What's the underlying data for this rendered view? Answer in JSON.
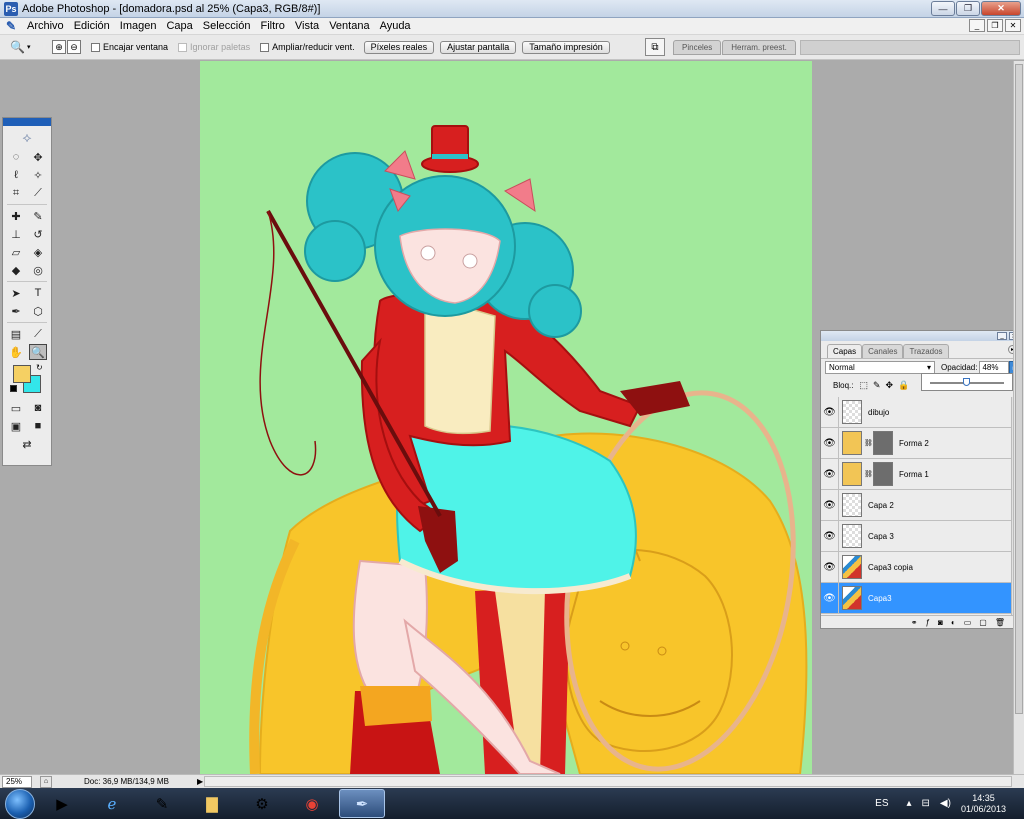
{
  "window": {
    "title": "Adobe Photoshop - [domadora.psd al 25% (Capa3, RGB/8#)]",
    "app_icon": "ps-icon",
    "buttons": [
      "minimize-icon",
      "restore-icon",
      "close-icon"
    ]
  },
  "menu": {
    "items": [
      "Archivo",
      "Edición",
      "Imagen",
      "Capa",
      "Selección",
      "Filtro",
      "Vista",
      "Ventana",
      "Ayuda"
    ]
  },
  "options": {
    "check_fit_window": "Encajar ventana",
    "check_ignore_palettes": "Ignorar paletas",
    "check_resize_windows": "Ampliar/reducir vent.",
    "btn_actual_pixels": "Píxeles reales",
    "btn_fit_screen": "Ajustar pantalla",
    "btn_print_size": "Tamaño impresión",
    "well_tabs": [
      "Pinceles",
      "Herram. preest."
    ]
  },
  "toolbox": {
    "foreground_color": "#f5d063",
    "background_color": "#33e6ea"
  },
  "layers_panel": {
    "tabs": [
      "Capas",
      "Canales",
      "Trazados"
    ],
    "blend_mode": "Normal",
    "opacity_label": "Opacidad:",
    "opacity_value": "48%",
    "opacity_fraction": 0.48,
    "lock_label": "Bloq.:",
    "layers": [
      {
        "name": "dibujo",
        "thumb": "transparent",
        "mask": false,
        "selected": false
      },
      {
        "name": "Forma 2",
        "thumb": "fill",
        "mask": true,
        "selected": false
      },
      {
        "name": "Forma 1",
        "thumb": "fill",
        "mask": true,
        "selected": false
      },
      {
        "name": "Capa 2",
        "thumb": "transparent",
        "mask": false,
        "selected": false
      },
      {
        "name": "Capa 3",
        "thumb": "transparent",
        "mask": false,
        "selected": false
      },
      {
        "name": "Capa3 copia",
        "thumb": "art",
        "mask": false,
        "selected": false
      },
      {
        "name": "Capa3",
        "thumb": "art",
        "mask": false,
        "selected": true
      }
    ]
  },
  "status": {
    "zoom": "25%",
    "doc_info": "Doc: 36,9 MB/134,9 MB"
  },
  "taskbar": {
    "lang": "ES",
    "time": "14:35",
    "date": "01/06/2013"
  },
  "colors": {
    "canvas_bg": "#a2e99c",
    "selection": "#3394ff"
  }
}
